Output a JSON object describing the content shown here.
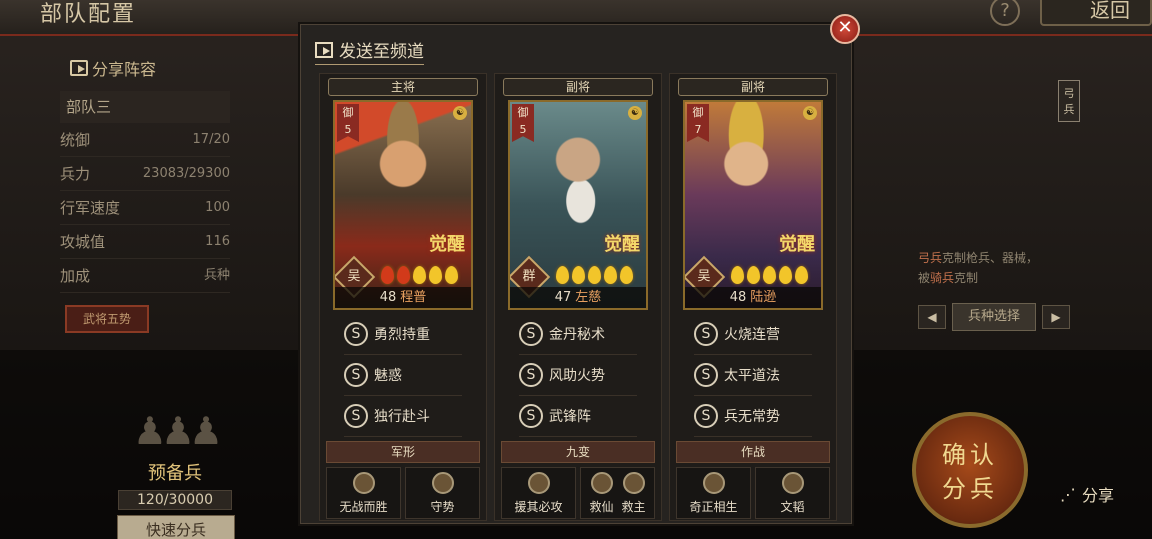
{
  "header": {
    "title": "部队配置",
    "help": "?",
    "back": "返回"
  },
  "left": {
    "share_lineup": "分享阵容",
    "troop": "部队三",
    "stats": [
      {
        "label": "统御",
        "value": "17/20"
      },
      {
        "label": "兵力",
        "value": "23083/29300"
      },
      {
        "label": "行军速度",
        "value": "100"
      },
      {
        "label": "攻城值",
        "value": "116"
      },
      {
        "label": "加成",
        "value": "兵种"
      }
    ],
    "wujiang_btn": "武将五势",
    "reserve_label": "预备兵",
    "reserve_count": "120/30000",
    "quick_btn": "快速分兵"
  },
  "right": {
    "unit_tag": "弓兵",
    "counter_prefix": "弓兵",
    "counter_line1": "克制枪兵、器械，",
    "counter_line2_a": "被",
    "counter_line2_k": "骑兵",
    "counter_line2_b": "克制",
    "select_btn": "兵种选择",
    "prev": "◀",
    "next": "▶"
  },
  "confirm": {
    "line1": "确认",
    "line2": "分兵"
  },
  "share": "分享",
  "modal": {
    "title": "发送至频道",
    "close": "✕",
    "generals": [
      {
        "role": "主将",
        "cost": "御",
        "cost_num": "5",
        "coin": "☯",
        "awaken": "觉醒",
        "faction": "吴",
        "level": "48",
        "name": "程普",
        "stars": [
          1,
          1,
          0,
          0,
          0
        ],
        "skills": [
          "勇烈持重",
          "魅惑",
          "独行赴斗"
        ],
        "section": "军形",
        "tactics": [
          {
            "names": [
              "无战而胜"
            ]
          },
          {
            "names": [
              "守势"
            ]
          }
        ]
      },
      {
        "role": "副将",
        "cost": "御",
        "cost_num": "5",
        "coin": "☯",
        "awaken": "觉醒",
        "faction": "群",
        "level": "47",
        "name": "左慈",
        "stars": [
          0,
          0,
          0,
          0,
          0
        ],
        "skills": [
          "金丹秘术",
          "风助火势",
          "武锋阵"
        ],
        "section": "九变",
        "tactics": [
          {
            "names": [
              "援其必攻"
            ]
          },
          {
            "names": [
              "救仙",
              "救主"
            ]
          }
        ]
      },
      {
        "role": "副将",
        "cost": "御",
        "cost_num": "7",
        "coin": "☯",
        "awaken": "觉醒",
        "faction": "吴",
        "level": "48",
        "name": "陆逊",
        "stars": [
          0,
          0,
          0,
          0,
          0
        ],
        "skills": [
          "火烧连营",
          "太平道法",
          "兵无常势"
        ],
        "section": "作战",
        "tactics": [
          {
            "names": [
              "奇正相生"
            ]
          },
          {
            "names": [
              "文韬"
            ]
          }
        ]
      }
    ],
    "skill_badge": "S"
  }
}
